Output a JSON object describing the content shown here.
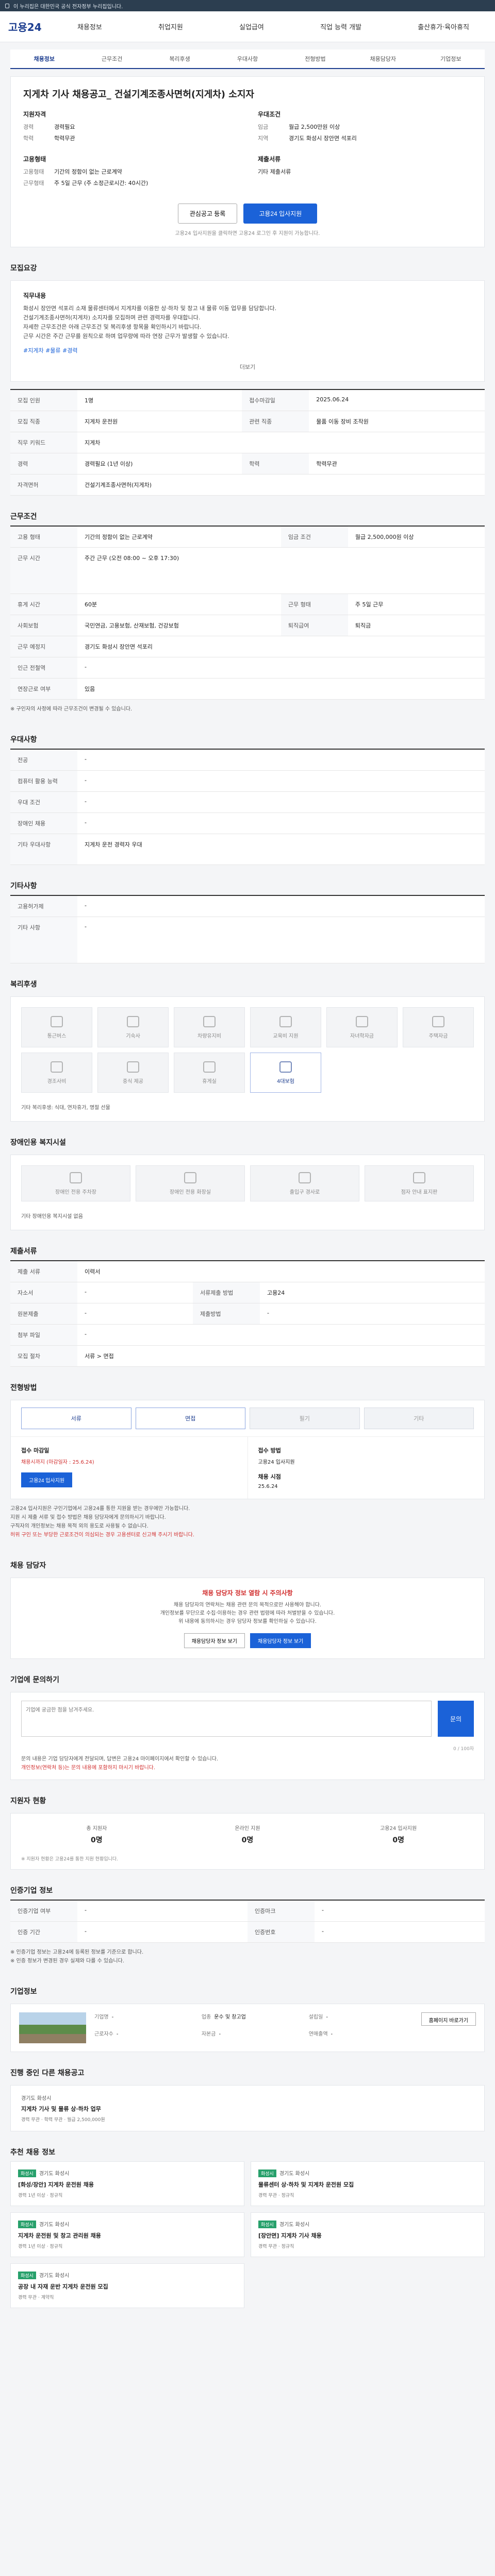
{
  "topbar": {
    "notice": "이 누리집은 대한민국 공식 전자정부 누리집입니다."
  },
  "gnb": {
    "logo": "고용24",
    "menu": [
      "채용정보",
      "취업지원",
      "실업급여",
      "직업 능력 개발",
      "출산휴가·육아휴직"
    ]
  },
  "tabs": [
    "채용정보",
    "근무조건",
    "복리후생",
    "우대사항",
    "전형방법",
    "채용담당자",
    "기업정보"
  ],
  "job": {
    "title": "지게차 기사 채용공고_ 건설기계조종사면허(지게차) 소지자",
    "left_heading": "지원자격",
    "left_rows": [
      {
        "k": "경력",
        "v": "경력필요"
      },
      {
        "k": "학력",
        "v": "학력무관"
      }
    ],
    "left_heading2": "고용형태",
    "left_rows2": [
      {
        "k": "고용형태",
        "v": "기간의 정함이 없는 근로계약"
      },
      {
        "k": "근무형태",
        "v": "주 5일 근무 (주 소정근로시간: 40시간)"
      }
    ],
    "right_heading": "우대조건",
    "right_rows": [
      {
        "k": "임금",
        "v": "월급 2,500만원 이상"
      },
      {
        "k": "지역",
        "v": "경기도 화성시 장안면 석포리"
      }
    ],
    "right_heading2": "제출서류",
    "right_rows2": [
      {
        "k": "",
        "v": "기타 제출서류"
      }
    ],
    "scrap_label": "관심공고 등록",
    "apply_label": "고용24 입사지원",
    "note": "고용24 입사지원을 클릭하면 고용24 로그인 후 지원이 가능합니다."
  },
  "sections": {
    "recruit": "모집요강",
    "work": "근무조건",
    "prefer": "우대사항",
    "extra": "기타사항",
    "welfare": "복리후생",
    "welfare_disabled": "장애인용 복지시설",
    "docs": "제출서류",
    "process": "전형방법",
    "manager": "채용 담당자",
    "qa": "기업에 문의하기",
    "status": "지원자 현황",
    "info": "인증기업 정보",
    "company": "기업정보",
    "related": "진행 중인 다른 채용공고",
    "recommend": "추천 채용 정보"
  },
  "recruit_desc": {
    "heading": "직무내용",
    "lines": [
      "화성시 장안면 석포리 소재 물류센터에서 지게차를 이용한 상·하차 및 창고 내 물류 이동 업무를 담당합니다.",
      "건설기계조종사면허(지게차) 소지자를 모집하며 관련 경력자를 우대합니다.",
      "자세한 근무조건은 아래 근무조건 및 복리후생 항목을 확인하시기 바랍니다.",
      "근무 시간은 주간 근무를 원칙으로 하며 업무량에 따라 연장 근무가 발생할 수 있습니다."
    ],
    "hashtags": "#지게차 #물류 #경력",
    "more": "더보기"
  },
  "recruit_table": [
    {
      "k": "모집 인원",
      "v": "1명",
      "k2": "접수마감일",
      "v2": "2025.06.24"
    },
    {
      "k": "모집 직종",
      "v": "지게차 운전원",
      "k2": "관련 직종",
      "v2": "물품 이동 장비 조작원"
    },
    {
      "k": "직무 키워드",
      "v": "지게차",
      "k2": "",
      "v2": ""
    },
    {
      "k": "경력",
      "v": "경력필요 (1년 이상)",
      "k2": "학력",
      "v2": "학력무관"
    },
    {
      "k": "자격면허",
      "v": "건설기계조종사면허(지게차)",
      "k2": "",
      "v2": ""
    }
  ],
  "work_table": [
    {
      "k": "고용 형태",
      "v": "기간의 정함이 없는 근로계약",
      "k2": "임금 조건",
      "v2": "월급 2,500,000원 이상"
    },
    {
      "k": "근무 시간",
      "v": "주간 근무 (오전 08:00 ~ 오후 17:30)",
      "k2": "",
      "v2": ""
    },
    {
      "k": "휴게 시간",
      "v": "60분",
      "k2": "근무 형태",
      "v2": "주 5일 근무"
    },
    {
      "k": "사회보험",
      "v": "국민연금, 고용보험, 산재보험, 건강보험",
      "k2": "퇴직급여",
      "v2": "퇴직금"
    },
    {
      "k": "근무 예정지",
      "v": "경기도 화성시 장안면 석포리",
      "k2": "",
      "v2": ""
    },
    {
      "k": "인근 전철역",
      "v": "-",
      "k2": "",
      "v2": ""
    },
    {
      "k": "연장근로 여부",
      "v": "있음",
      "k2": "",
      "v2": ""
    }
  ],
  "work_footnote": "※ 구인자의 사정에 따라 근무조건이 변경될 수 있습니다.",
  "prefer_table": [
    {
      "k": "전공",
      "v": "-"
    },
    {
      "k": "컴퓨터 활용 능력",
      "v": "-"
    },
    {
      "k": "우대 조건",
      "v": "-"
    },
    {
      "k": "장애인 채용",
      "v": "-"
    },
    {
      "k": "기타 우대사항",
      "v": "지게차 운전 경력자 우대"
    }
  ],
  "extra_table": [
    {
      "k": "고용허가제",
      "v": "-"
    },
    {
      "k": "기타 사항",
      "v": "-"
    }
  ],
  "welfare_tiles": [
    {
      "label": "통근버스",
      "on": false
    },
    {
      "label": "기숙사",
      "on": false
    },
    {
      "label": "차량유지비",
      "on": false
    },
    {
      "label": "교육비 지원",
      "on": false
    },
    {
      "label": "자녀학자금",
      "on": false
    },
    {
      "label": "주택자금",
      "on": false
    },
    {
      "label": "경조사비",
      "on": false
    },
    {
      "label": "중식 제공",
      "on": false
    },
    {
      "label": "휴게실",
      "on": false
    },
    {
      "label": "4대보험",
      "on": true
    }
  ],
  "welfare_text": "기타 복리후생: 식대, 연차휴가, 명절 선물",
  "welfare_disabled_tiles": [
    {
      "label": "장애인 전용 주차장"
    },
    {
      "label": "장애인 전용 화장실"
    },
    {
      "label": "출입구 경사로"
    },
    {
      "label": "점자 안내 표지판"
    }
  ],
  "welfare_disabled_note": "기타 장애인용 복지시설 없음",
  "docs_table": [
    {
      "k": "제출 서류",
      "v": "이력서",
      "k2": "",
      "v2": ""
    },
    {
      "k": "자소서",
      "v": "-",
      "k2": "서류제출 방법",
      "v2": "고용24"
    },
    {
      "k": "원본제출",
      "v": "-",
      "k2": "제출방법",
      "v2": "-"
    },
    {
      "k": "첨부 파일",
      "v": "-",
      "k2": "",
      "v2": ""
    },
    {
      "k": "모집 절차",
      "v": "서류 > 면접",
      "k2": "",
      "v2": ""
    }
  ],
  "process_methods": [
    {
      "label": "서류",
      "on": true
    },
    {
      "label": "면접",
      "on": true
    },
    {
      "label": "필기",
      "on": false
    },
    {
      "label": "기타",
      "on": false
    }
  ],
  "process_detail": {
    "left_label": "접수 마감일",
    "left_value": "채용시까지 (마감일자 : 25.6.24)",
    "apply": "고용24 입사지원",
    "right_label": "접수 방법",
    "right_value": "고용24 입사지원",
    "result_label": "채용 시점",
    "result_value": "25.6.24"
  },
  "process_notes": [
    "고용24 입사지원은 구인기업에서 고용24를 통한 지원을 받는 경우에만 가능합니다.",
    "지원 시 제출 서류 및 접수 방법은 채용 담당자에게 문의하시기 바랍니다.",
    "구직자의 개인정보는 채용 목적 외의 용도로 사용될 수 없습니다.",
    "허위 구인 또는 부당한 근로조건이 의심되는 경우 고용센터로 신고해 주시기 바랍니다."
  ],
  "manager": {
    "warn_title": "채용 담당자 정보 열람 시 주의사항",
    "lines": [
      "채용 담당자의 연락처는 채용 관련 문의 목적으로만 사용해야 합니다.",
      "개인정보를 무단으로 수집·이용하는 경우 관련 법령에 따라 처벌받을 수 있습니다.",
      "위 내용에 동의하시는 경우 담당자 정보를 확인하실 수 있습니다."
    ],
    "btn1": "채용담당자 정보 보기",
    "btn2": "채용담당자 정보 보기"
  },
  "qa": {
    "placeholder": "기업에 궁금한 점을 남겨주세요.",
    "submit": "문의",
    "notes": [
      "문의 내용은 기업 담당자에게 전달되며, 답변은 고용24 마이페이지에서 확인할 수 있습니다.",
      "개인정보(연락처 등)는 문의 내용에 포함하지 마시기 바랍니다."
    ],
    "counter": "0 / 100자"
  },
  "status": {
    "items": [
      {
        "label": "총 지원자",
        "value": "0명"
      },
      {
        "label": "온라인 지원",
        "value": "0명"
      },
      {
        "label": "고용24 입사지원",
        "value": "0명"
      }
    ],
    "note": "※ 지원자 현황은 고용24를 통한 지원 현황입니다."
  },
  "info_table": [
    {
      "k": "인증기업 여부",
      "v": "-",
      "k2": "인증마크",
      "v2": "-"
    },
    {
      "k": "인증 기간",
      "v": "-",
      "k2": "인증번호",
      "v2": "-"
    }
  ],
  "info_notes": [
    "※ 인증기업 정보는 고용24에 등록된 정보를 기준으로 합니다.",
    "※ 인증 정보가 변경된 경우 실제와 다를 수 있습니다."
  ],
  "company": {
    "rows": [
      {
        "k": "기업명",
        "v": "-"
      },
      {
        "k": "업종",
        "v": "운수 및 창고업"
      },
      {
        "k": "설립일",
        "v": "-"
      },
      {
        "k": "근로자수",
        "v": "-"
      },
      {
        "k": "자본금",
        "v": "-"
      },
      {
        "k": "연매출액",
        "v": "-"
      }
    ],
    "homepage": "홈페이지 바로가기"
  },
  "related": {
    "title": "지게차 기사 및 물류 상·하차 업무",
    "company": "경기도 화성시",
    "meta": "경력 무관 · 학력 무관 · 월급 2,500,000원"
  },
  "recommend": [
    {
      "tag": "화성시",
      "company": "경기도 화성시",
      "title": "[화성/장안] 지게차 운전원 채용",
      "meta": "경력 1년 이상 · 정규직"
    },
    {
      "tag": "화성시",
      "company": "경기도 화성시",
      "title": "물류센터 상·하차 및 지게차 운전원 모집",
      "meta": "경력 무관 · 정규직"
    },
    {
      "tag": "화성시",
      "company": "경기도 화성시",
      "title": "지게차 운전원 및 창고 관리원 채용",
      "meta": "경력 1년 이상 · 정규직"
    },
    {
      "tag": "화성시",
      "company": "경기도 화성시",
      "title": "[장안면] 지게차 기사 채용",
      "meta": "경력 무관 · 정규직"
    },
    {
      "tag": "화성시",
      "company": "경기도 화성시",
      "title": "공장 내 자재 운반 지게차 운전원 모집",
      "meta": "경력 무관 · 계약직"
    }
  ]
}
